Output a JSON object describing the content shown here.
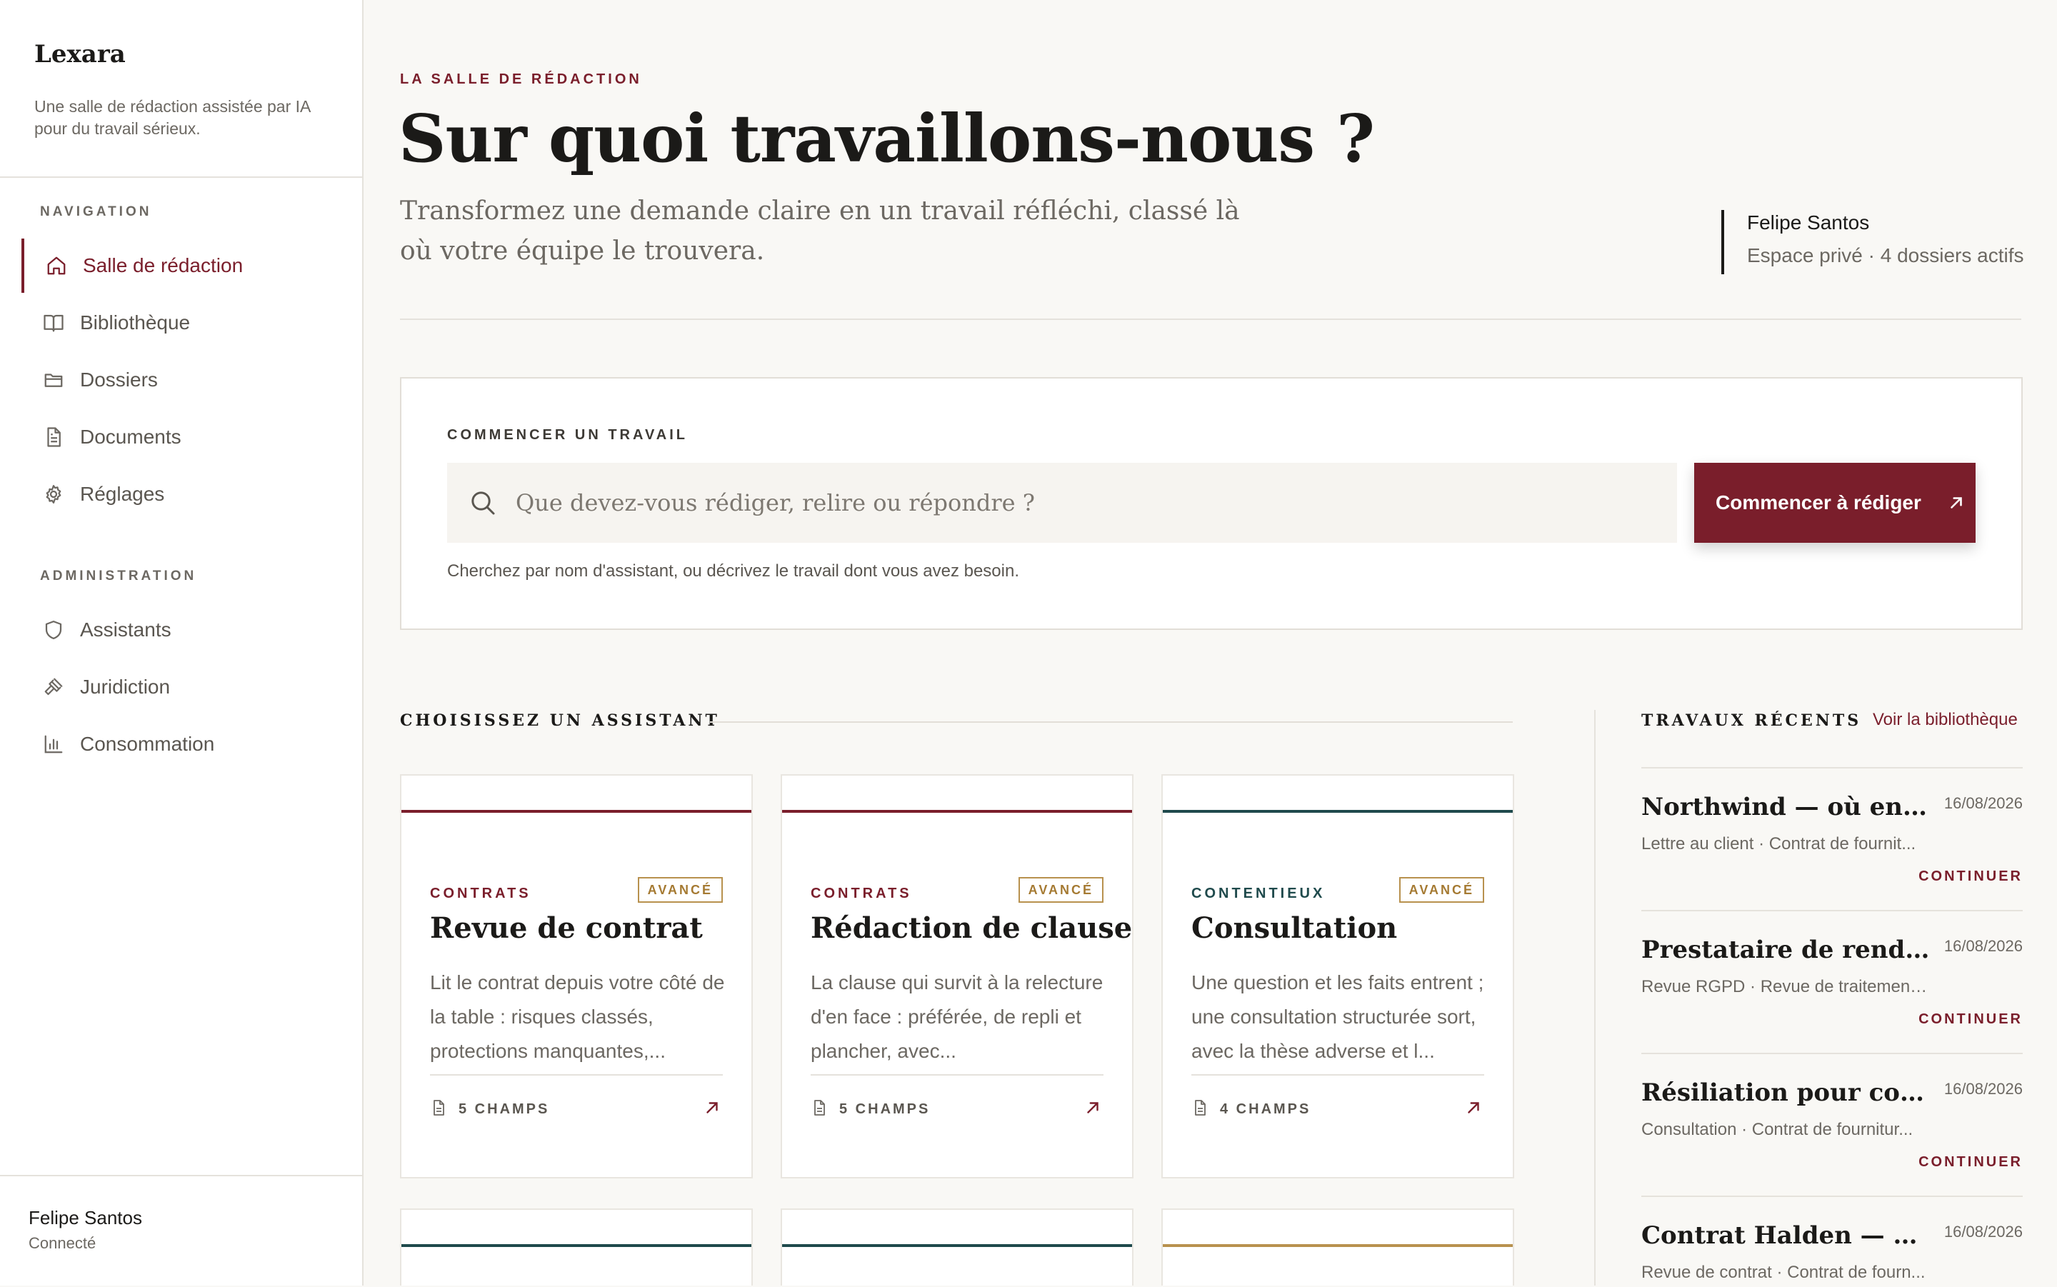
{
  "colors": {
    "accent": "#7a1e2b",
    "teal": "#1f4a4c",
    "gold": "#b8914e"
  },
  "sidebar": {
    "brand": "Lexara",
    "tagline": "Une salle de rédaction assistée par IA pour du travail sérieux.",
    "nav_label": "NAVIGATION",
    "nav_items": [
      {
        "label": "Salle de rédaction",
        "icon": "home-icon",
        "active": true
      },
      {
        "label": "Bibliothèque",
        "icon": "book-icon"
      },
      {
        "label": "Dossiers",
        "icon": "folder-icon"
      },
      {
        "label": "Documents",
        "icon": "document-icon"
      },
      {
        "label": "Réglages",
        "icon": "gear-icon"
      }
    ],
    "admin_label": "ADMINISTRATION",
    "admin_items": [
      {
        "label": "Assistants",
        "icon": "shield-icon"
      },
      {
        "label": "Juridiction",
        "icon": "gavel-icon"
      },
      {
        "label": "Consommation",
        "icon": "bar-chart-icon"
      }
    ],
    "user": {
      "name": "Felipe Santos",
      "status": "Connecté"
    }
  },
  "header": {
    "eyebrow": "LA SALLE DE RÉDACTION",
    "title": "Sur quoi travaillons-nous ?",
    "subtitle": "Transformez une demande claire en un travail réfléchi, classé là où votre équipe le trouvera.",
    "account_name": "Felipe Santos",
    "account_meta": "Espace privé · 4 dossiers actifs"
  },
  "start": {
    "label": "COMMENCER UN TRAVAIL",
    "placeholder": "Que devez-vous rédiger, relire ou répondre ?",
    "value": "",
    "button": "Commencer à rédiger",
    "hint": "Cherchez par nom d'assistant, ou décrivez le travail dont vous avez besoin."
  },
  "assistants": {
    "title": "CHOISISSEZ UN ASSISTANT",
    "cards": [
      {
        "category": "CONTRATS",
        "level": "AVANCÉ",
        "title": "Revue de contrat",
        "description": "Lit le contrat depuis votre côté de la table : risques classés, protections manquantes,...",
        "fields": "5 CHAMPS",
        "bar_color": "#7a1e2b",
        "category_color": "#7a1e2b"
      },
      {
        "category": "CONTRATS",
        "level": "AVANCÉ",
        "title": "Rédaction de clause",
        "description": "La clause qui survit à la relecture d'en face : préférée, de repli et plancher, avec...",
        "fields": "5 CHAMPS",
        "bar_color": "#7a1e2b",
        "category_color": "#7a1e2b"
      },
      {
        "category": "CONTENTIEUX",
        "level": "AVANCÉ",
        "title": "Consultation",
        "description": "Une question et les faits entrent ; une consultation structurée sort, avec la thèse adverse et l...",
        "fields": "4 CHAMPS",
        "bar_color": "#1f4a4c",
        "category_color": "#1f4a4c"
      }
    ],
    "partial_cards": [
      {
        "bar_color": "#1f4a4c"
      },
      {
        "bar_color": "#1f4a4c"
      },
      {
        "bar_color": "#b8914e"
      }
    ]
  },
  "recent": {
    "title": "TRAVAUX RÉCENTS",
    "link": "Voir la bibliothèque",
    "continue_label": "CONTINUER",
    "items": [
      {
        "title": "Northwind — où en est l...",
        "date": "16/08/2026",
        "meta": "Lettre au client · Contrat de fournit..."
      },
      {
        "title": "Prestataire de rendez-vo...",
        "date": "16/08/2026",
        "meta": "Revue RGPD · Revue de traitement ..."
      },
      {
        "title": "Résiliation pour conven...",
        "date": "16/08/2026",
        "meta": "Consultation · Contrat de fournitur..."
      },
      {
        "title": "Contrat Halden — revue ...",
        "date": "16/08/2026",
        "meta": "Revue de contrat · Contrat de fourn..."
      }
    ]
  }
}
